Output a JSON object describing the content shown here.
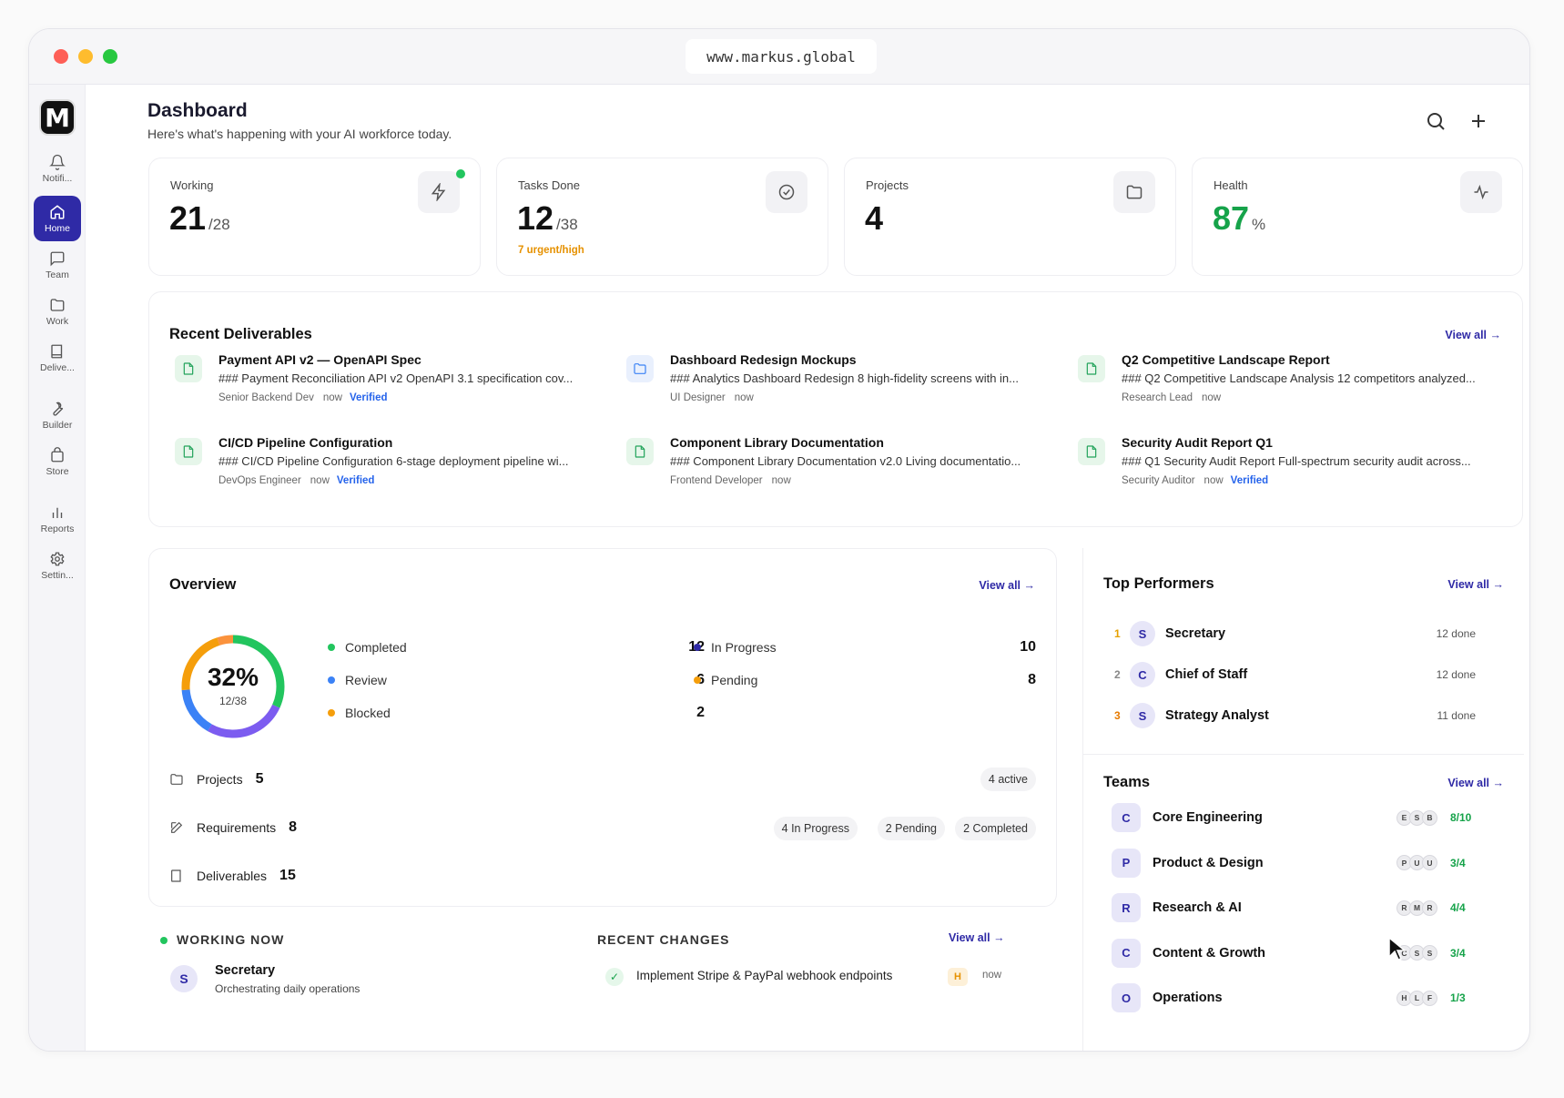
{
  "browser": {
    "url": "www.markus.global"
  },
  "logo": {
    "letter": "M"
  },
  "nav": [
    {
      "label": "Notifi...",
      "icon": "bell-icon"
    },
    {
      "label": "Home",
      "icon": "home-icon",
      "active": true
    },
    {
      "label": "Team",
      "icon": "chat-icon"
    },
    {
      "label": "Work",
      "icon": "folder-icon"
    },
    {
      "label": "Delive...",
      "icon": "book-icon"
    },
    {
      "label": "Builder",
      "icon": "wrench-icon"
    },
    {
      "label": "Store",
      "icon": "bag-icon"
    },
    {
      "label": "Reports",
      "icon": "bar-chart-icon"
    },
    {
      "label": "Settin...",
      "icon": "gear-icon"
    }
  ],
  "header": {
    "title": "Dashboard",
    "subtitle": "Here's what's happening with your AI workforce today."
  },
  "stats": [
    {
      "label": "Working",
      "value": "21",
      "unit": "/28",
      "icon": "bolt-icon",
      "note": ""
    },
    {
      "label": "Tasks Done",
      "value": "12",
      "unit": "/38",
      "icon": "check-circle-icon",
      "note": "7 urgent/high"
    },
    {
      "label": "Projects",
      "value": "4",
      "unit": "",
      "icon": "folder-icon",
      "note": ""
    },
    {
      "label": "Health",
      "value": "87",
      "unit": "%",
      "icon": "pulse-icon",
      "note": ""
    }
  ],
  "colors": {
    "accent": "#2f2aa6",
    "green": "#16a34a",
    "orange": "#e69100",
    "blue": "#2563eb",
    "purple": "#7c5cf0"
  },
  "deliverables": {
    "title": "Recent Deliverables",
    "view_all": "View all →",
    "items": [
      {
        "title": "Payment API v2 — OpenAPI Spec",
        "desc": "### Payment Reconciliation API v2 OpenAPI 3.1 specification cov...",
        "role": "Senior Backend Dev",
        "time": "now",
        "status": "Verified",
        "kind": "doc"
      },
      {
        "title": "Dashboard Redesign Mockups",
        "desc": "### Analytics Dashboard Redesign 8 high-fidelity screens with in...",
        "role": "UI Designer",
        "time": "now",
        "status": "",
        "kind": "folder"
      },
      {
        "title": "Q2 Competitive Landscape Report",
        "desc": "### Q2 Competitive Landscape Analysis 12 competitors analyzed...",
        "role": "Research Lead",
        "time": "now",
        "status": "",
        "kind": "doc"
      },
      {
        "title": "CI/CD Pipeline Configuration",
        "desc": "### CI/CD Pipeline Configuration 6-stage deployment pipeline wi...",
        "role": "DevOps Engineer",
        "time": "now",
        "status": "Verified",
        "kind": "doc"
      },
      {
        "title": "Component Library Documentation",
        "desc": "### Component Library Documentation v2.0 Living documentatio...",
        "role": "Frontend Developer",
        "time": "now",
        "status": "",
        "kind": "doc"
      },
      {
        "title": "Security Audit Report Q1",
        "desc": "### Q1 Security Audit Report Full-spectrum security audit across...",
        "role": "Security Auditor",
        "time": "now",
        "status": "Verified",
        "kind": "doc"
      }
    ]
  },
  "overview": {
    "title": "Overview",
    "view_all": "View all →",
    "donut": {
      "percent": "32%",
      "fraction": "12/38"
    },
    "legend": [
      {
        "label": "Completed",
        "value": "12",
        "color": "#22c55e"
      },
      {
        "label": "In Progress",
        "value": "10",
        "color": "#2f2aa6"
      },
      {
        "label": "Review",
        "value": "6",
        "color": "#3b82f6"
      },
      {
        "label": "Pending",
        "value": "8",
        "color": "#f59e0b"
      },
      {
        "label": "Blocked",
        "value": "2",
        "color": "#f59e0b"
      }
    ],
    "projects": {
      "label": "Projects",
      "count": "5",
      "chip": "4 active"
    },
    "requirements": {
      "label": "Requirements",
      "count": "8",
      "chips": [
        "4 In Progress",
        "2 Pending",
        "2 Completed"
      ]
    },
    "deliverables": {
      "label": "Deliverables",
      "count": "15"
    }
  },
  "working_now": {
    "title": "WORKING NOW",
    "agent": {
      "initial": "S",
      "name": "Secretary",
      "task": "Orchestrating daily operations"
    }
  },
  "recent_changes": {
    "title": "RECENT CHANGES",
    "view_all": "View all →",
    "item": {
      "text": "Implement Stripe & PayPal webhook endpoints",
      "priority": "H",
      "time": "now"
    }
  },
  "top_performers": {
    "title": "Top Performers",
    "view_all": "View all →",
    "items": [
      {
        "rank": "1",
        "initial": "S",
        "name": "Secretary",
        "done": "12 done",
        "rank_color": "#e6a100"
      },
      {
        "rank": "2",
        "initial": "C",
        "name": "Chief of Staff",
        "done": "12 done",
        "rank_color": "#888888"
      },
      {
        "rank": "3",
        "initial": "S",
        "name": "Strategy Analyst",
        "done": "11 done",
        "rank_color": "#e67a00"
      }
    ]
  },
  "teams": {
    "title": "Teams",
    "view_all": "View all →",
    "items": [
      {
        "initial": "C",
        "name": "Core Engineering",
        "members": [
          "E",
          "S",
          "B"
        ],
        "count": "8/10"
      },
      {
        "initial": "P",
        "name": "Product & Design",
        "members": [
          "P",
          "U",
          "U"
        ],
        "count": "3/4"
      },
      {
        "initial": "R",
        "name": "Research & AI",
        "members": [
          "R",
          "M",
          "R"
        ],
        "count": "4/4"
      },
      {
        "initial": "C",
        "name": "Content & Growth",
        "members": [
          "C",
          "S",
          "S"
        ],
        "count": "3/4"
      },
      {
        "initial": "O",
        "name": "Operations",
        "members": [
          "H",
          "L",
          "F"
        ],
        "count": "1/3"
      }
    ]
  }
}
